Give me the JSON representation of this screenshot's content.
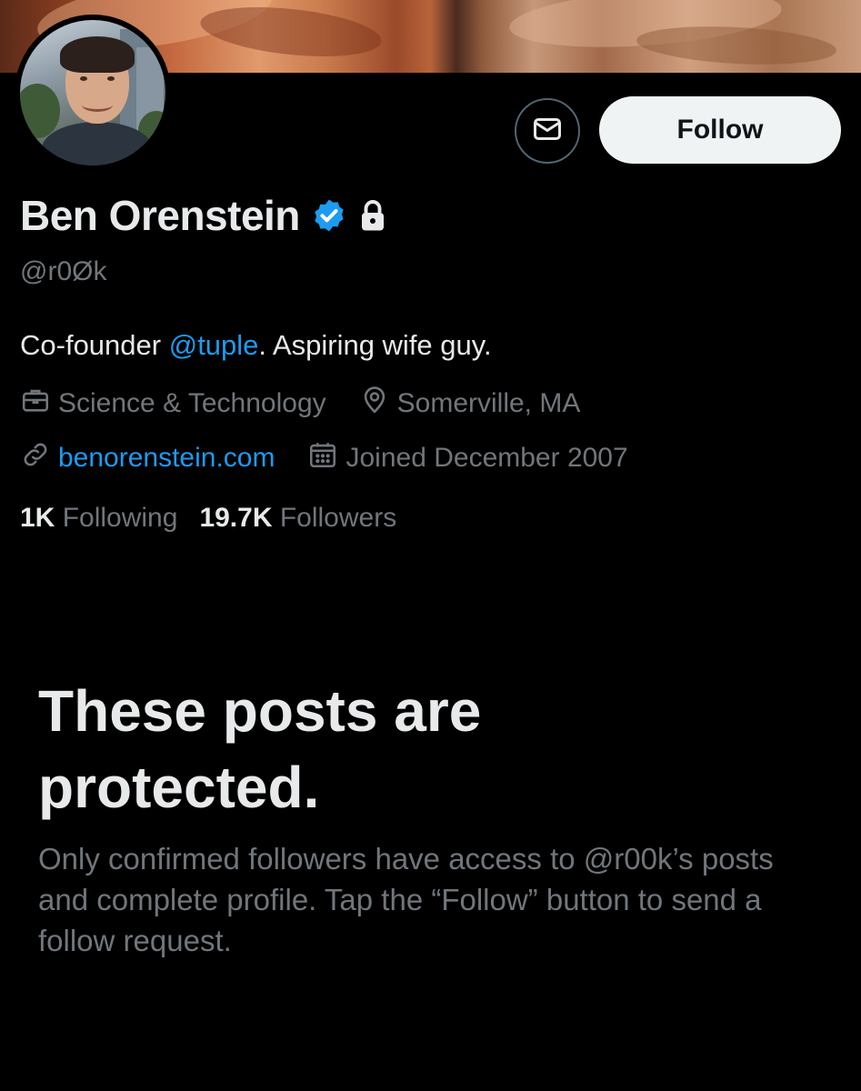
{
  "profile": {
    "name": "Ben Orenstein",
    "handle": "@r0Øk",
    "bio_prefix": "Co-founder ",
    "bio_mention": "@tuple",
    "bio_suffix": ". Aspiring wife guy.",
    "category": "Science & Technology",
    "location": "Somerville, MA",
    "website": "benorenstein.com",
    "joined": "Joined December 2007"
  },
  "stats": {
    "following_count": "1K",
    "following_label": "Following",
    "followers_count": "19.7K",
    "followers_label": "Followers"
  },
  "actions": {
    "follow_label": "Follow"
  },
  "protected": {
    "title": "These posts are protected.",
    "description": "Only confirmed followers have access to @r00k’s posts and complete profile. Tap the “Follow” button to send a follow request."
  },
  "icons": {
    "verified": "verified-badge-icon",
    "lock": "lock-icon",
    "mail": "mail-icon",
    "category": "briefcase-icon",
    "location": "location-pin-icon",
    "website": "link-icon",
    "joined": "calendar-icon"
  },
  "colors": {
    "background": "#000000",
    "text_primary": "#e7e9ea",
    "text_secondary": "#71767b",
    "accent": "#1d9bf0",
    "follow_button_bg": "#eff3f4"
  }
}
